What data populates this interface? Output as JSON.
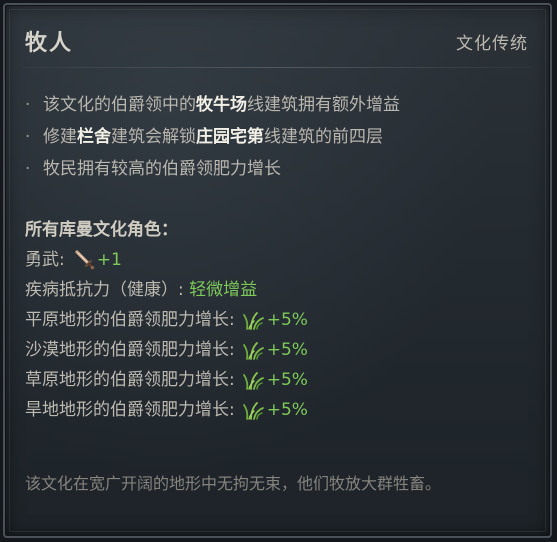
{
  "header": {
    "title": "牧人",
    "category": "文化传统"
  },
  "description": {
    "line1": {
      "pre": "该文化的伯爵领中的",
      "hl": "牧牛场",
      "post": "线建筑拥有额外增益"
    },
    "line2": {
      "pre": "修建",
      "hl1": "栏舍",
      "mid": "建筑会解锁",
      "hl2": "庄园宅第",
      "post": "线建筑的前四层"
    },
    "line3": {
      "text": "牧民拥有较高的伯爵领肥力增长"
    },
    "bullet_glyph": "·"
  },
  "modifiers": {
    "title": "所有库曼文化角色：",
    "prowess": {
      "label": "勇武:",
      "icon": "prowess-sword-icon",
      "value": "+1"
    },
    "disease": {
      "label": "疾病抵抗力（健康）:",
      "value": "轻微增益"
    },
    "terrain": [
      {
        "label": "平原地形的伯爵领肥力增长:",
        "icon": "grass-fertility-icon",
        "value": "+5%"
      },
      {
        "label": "沙漠地形的伯爵领肥力增长:",
        "icon": "grass-fertility-icon",
        "value": "+5%"
      },
      {
        "label": "草原地形的伯爵领肥力增长:",
        "icon": "grass-fertility-icon",
        "value": "+5%"
      },
      {
        "label": "旱地地形的伯爵领肥力增长:",
        "icon": "grass-fertility-icon",
        "value": "+5%"
      }
    ]
  },
  "flavor": "该文化在宽广开阔的地形中无拘无束，他们牧放大群牲畜。",
  "colors": {
    "positive": "#7ec95a",
    "highlight": "#f2efe6",
    "text": "#bdb9b0"
  }
}
